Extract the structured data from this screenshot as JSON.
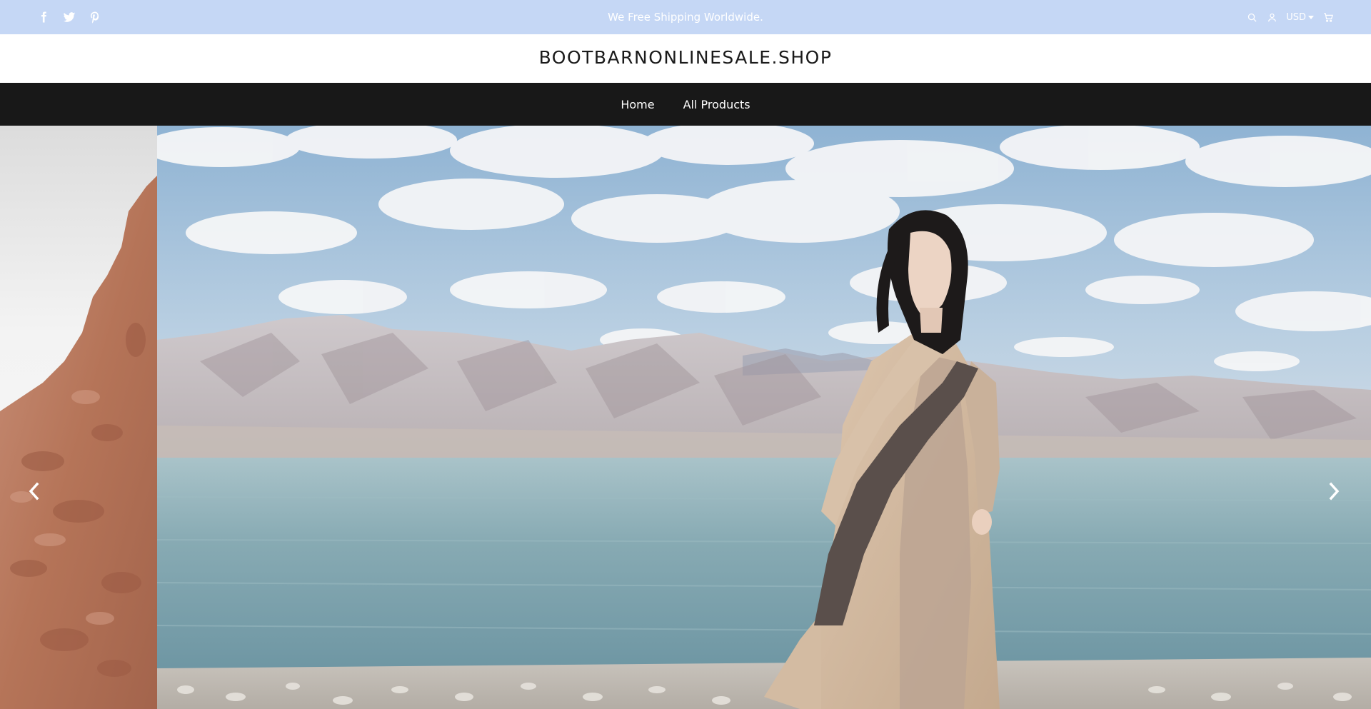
{
  "announcement": {
    "text": "We Free Shipping Worldwide."
  },
  "social": {
    "icons": [
      "facebook-icon",
      "twitter-icon",
      "pinterest-icon"
    ]
  },
  "header_tools": {
    "icons": [
      "search-icon",
      "user-icon",
      "cart-icon"
    ],
    "currency": "USD"
  },
  "logo": {
    "text": "BOOTBARNONLINESALE.SHOP"
  },
  "nav": {
    "items": [
      {
        "label": "Home"
      },
      {
        "label": "All Products"
      }
    ]
  },
  "slider": {
    "arrows": [
      "chevron-left-icon",
      "chevron-right-icon"
    ]
  },
  "colors": {
    "announcement_bg": "#c5d7f5",
    "nav_bg": "#181818",
    "text_dark": "#1a1a1a",
    "text_light": "#ffffff"
  }
}
